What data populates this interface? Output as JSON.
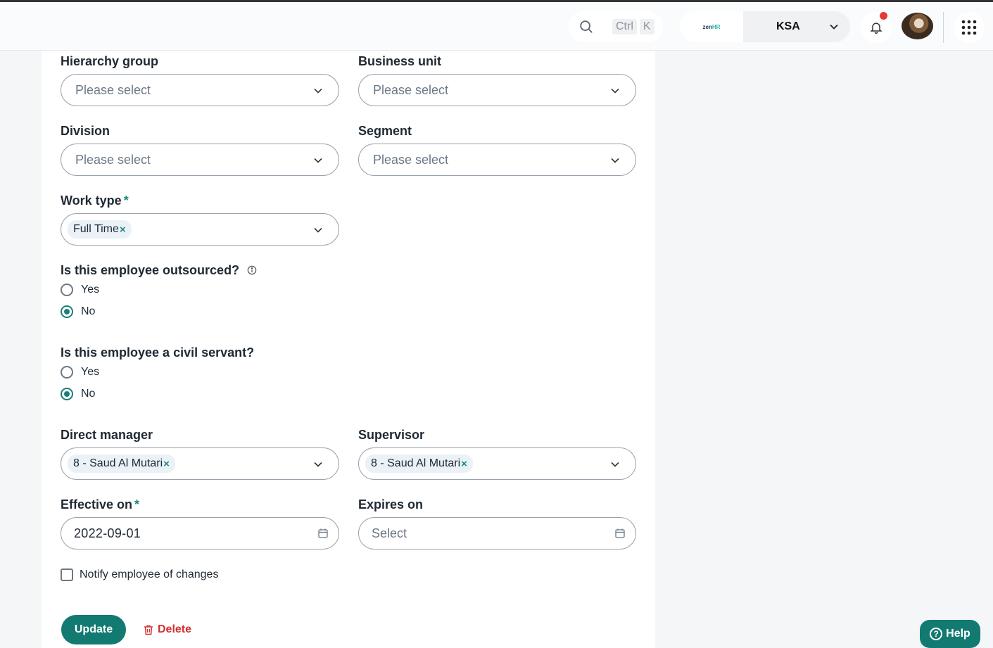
{
  "header": {
    "search": {
      "kbd_ctrl": "Ctrl",
      "kbd_k": "K"
    },
    "company": {
      "logo_text_a": "zen",
      "logo_text_b": "HR",
      "name": "KSA"
    },
    "colors": {
      "accent": "#137a72",
      "notification": "#e53935"
    }
  },
  "form": {
    "hierarchy_group": {
      "label": "Hierarchy group",
      "placeholder": "Please select"
    },
    "business_unit": {
      "label": "Business unit",
      "placeholder": "Please select"
    },
    "division": {
      "label": "Division",
      "placeholder": "Please select"
    },
    "segment": {
      "label": "Segment",
      "placeholder": "Please select"
    },
    "work_type": {
      "label": "Work type",
      "required": "*",
      "value": "Full Time",
      "remove": "×"
    },
    "outsourced": {
      "label": "Is this employee outsourced?",
      "options": [
        "Yes",
        "No"
      ],
      "selected": "No"
    },
    "civil_servant": {
      "label": "Is this employee a civil servant?",
      "options": [
        "Yes",
        "No"
      ],
      "selected": "No"
    },
    "direct_manager": {
      "label": "Direct manager",
      "value": "8 - Saud Al Mutari",
      "remove": "×"
    },
    "supervisor": {
      "label": "Supervisor",
      "value": "8 - Saud Al Mutari",
      "remove": "×"
    },
    "effective_on": {
      "label": "Effective on",
      "required": "*",
      "value": "2022-09-01"
    },
    "expires_on": {
      "label": "Expires on",
      "placeholder": "Select"
    },
    "notify": {
      "label": "Notify employee of changes",
      "checked": false
    }
  },
  "actions": {
    "update": "Update",
    "delete": "Delete",
    "help": "Help"
  }
}
